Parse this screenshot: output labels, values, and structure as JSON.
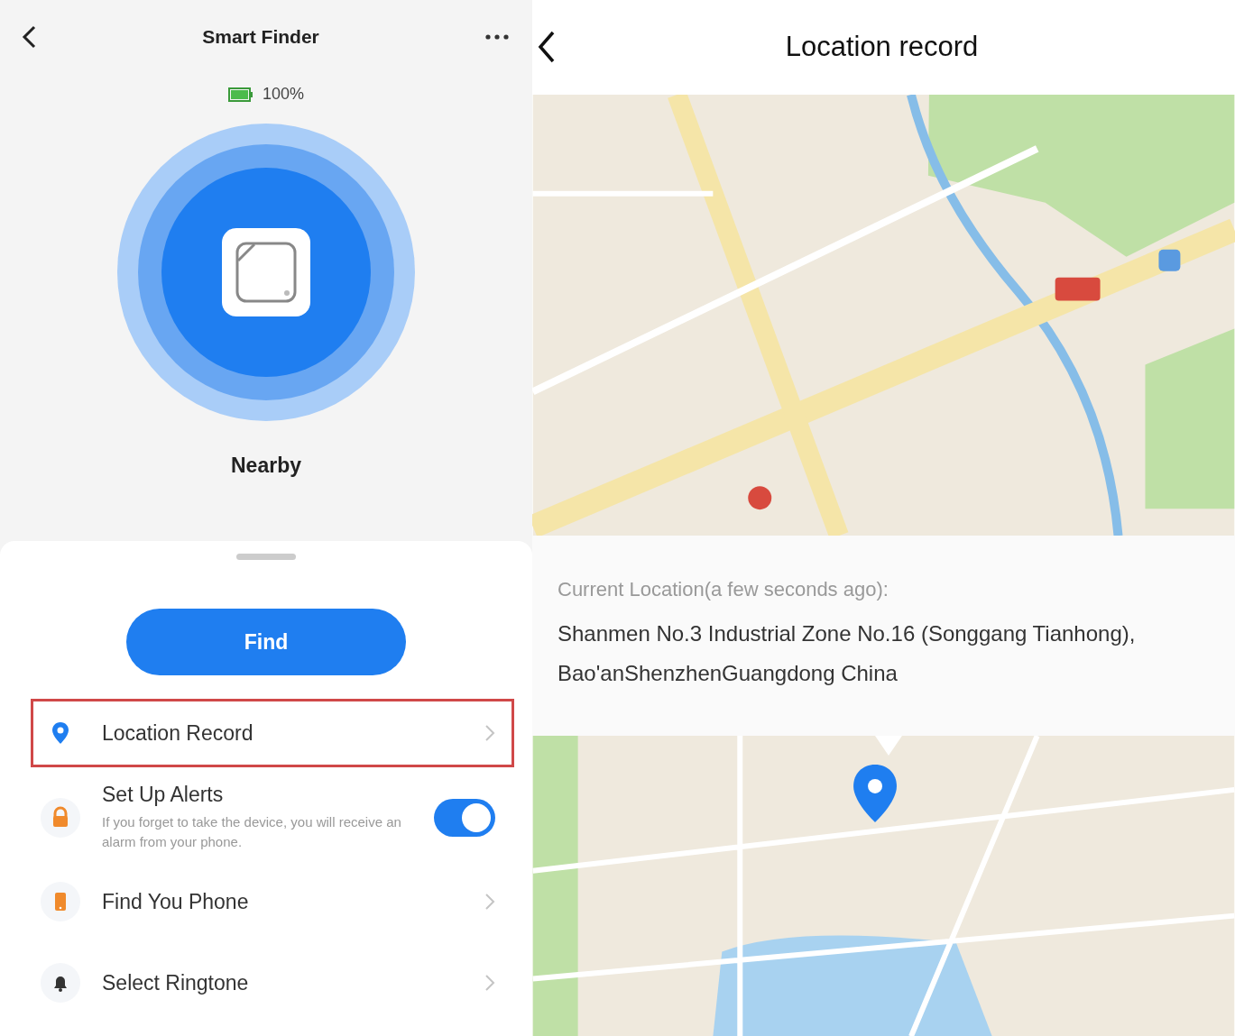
{
  "finder": {
    "title": "Smart Finder",
    "battery": "100%",
    "status": "Nearby",
    "find_button": "Find",
    "menu": [
      {
        "kind": "link",
        "label": "Location Record",
        "selected": true
      },
      {
        "kind": "toggle",
        "label": "Set Up Alerts",
        "description": "If you forget to take the device, you will receive an alarm from your phone.",
        "on": true,
        "selected": false
      },
      {
        "kind": "link",
        "label": "Find You Phone",
        "selected": false
      },
      {
        "kind": "link",
        "label": "Select Ringtone",
        "selected": false
      }
    ]
  },
  "record": {
    "title": "Location record",
    "caption": "Current Location(a few seconds ago):",
    "address": "Shanmen No.3 Industrial Zone No.16 (Songgang Tianhong), Bao'anShenzhenGuangdong China"
  }
}
